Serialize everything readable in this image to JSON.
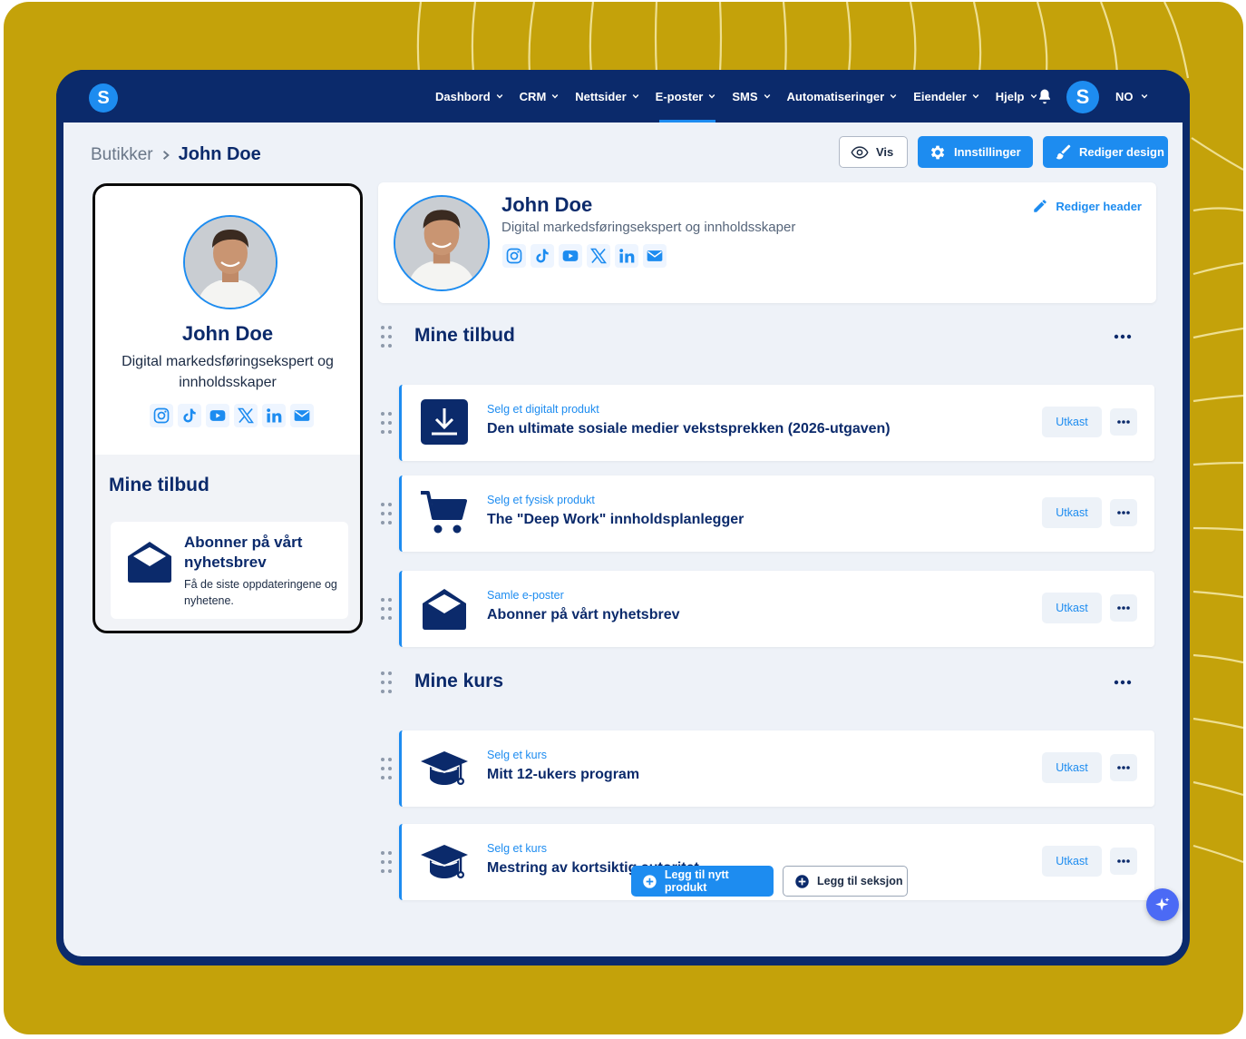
{
  "colors": {
    "backdrop": "#c4a20a",
    "navbar": "#0b2a6b",
    "accent": "#1d8cf0",
    "content_bg": "#eef2f8",
    "heading": "#0b2a6b"
  },
  "nav": {
    "logo_letter": "S",
    "items": [
      {
        "label": "Dashbord",
        "has_dropdown": true,
        "active": false
      },
      {
        "label": "CRM",
        "has_dropdown": true,
        "active": false
      },
      {
        "label": "Nettsider",
        "has_dropdown": true,
        "active": false
      },
      {
        "label": "E-poster",
        "has_dropdown": true,
        "active": true
      },
      {
        "label": "SMS",
        "has_dropdown": true,
        "active": false
      },
      {
        "label": "Automatiseringer",
        "has_dropdown": true,
        "active": false
      },
      {
        "label": "Eiendeler",
        "has_dropdown": true,
        "active": false
      },
      {
        "label": "Hjelp",
        "has_dropdown": true,
        "active": false
      }
    ],
    "notification_icon": "bell-icon",
    "avatar_letter": "S",
    "language": "NO"
  },
  "breadcrumb": {
    "parent": "Butikker",
    "current": "John Doe"
  },
  "toolbar": {
    "view_label": "Vis",
    "settings_label": "Innstillinger",
    "design_label": "Rediger design"
  },
  "preview": {
    "name": "John Doe",
    "subtitle": "Digital markedsføringsekspert og innholdsskaper",
    "section_title": "Mine tilbud",
    "card": {
      "title": "Abonner på vårt nyhetsbrev",
      "description": "Få de siste oppdateringene og nyhetene."
    }
  },
  "profile": {
    "name": "John Doe",
    "subtitle": "Digital markedsføringsekspert og innholdsskaper",
    "edit_label": "Rediger header",
    "socials": [
      "instagram-icon",
      "tiktok-icon",
      "youtube-icon",
      "x-icon",
      "linkedin-icon",
      "email-icon"
    ]
  },
  "sections": [
    {
      "title": "Mine tilbud",
      "items": [
        {
          "kind": "Selg et digitalt produkt",
          "title": "Den ultimate sosiale medier vekstsprekken (2026-utgaven)",
          "status": "Utkast",
          "icon": "download-icon"
        },
        {
          "kind": "Selg et fysisk produkt",
          "title": "The \"Deep Work\" innholdsplanlegger",
          "status": "Utkast",
          "icon": "cart-icon"
        },
        {
          "kind": "Samle e-poster",
          "title": "Abonner på vårt nyhetsbrev",
          "status": "Utkast",
          "icon": "envelope-icon"
        }
      ]
    },
    {
      "title": "Mine kurs",
      "items": [
        {
          "kind": "Selg et kurs",
          "title": "Mitt 12-ukers program",
          "status": "Utkast",
          "icon": "graduation-cap-icon"
        },
        {
          "kind": "Selg et kurs",
          "title": "Mestring av kortsiktig autoritet",
          "status": "Utkast",
          "icon": "graduation-cap-icon"
        }
      ]
    }
  ],
  "actions": {
    "add_product": "Legg til nytt produkt",
    "add_section": "Legg til seksjon"
  }
}
